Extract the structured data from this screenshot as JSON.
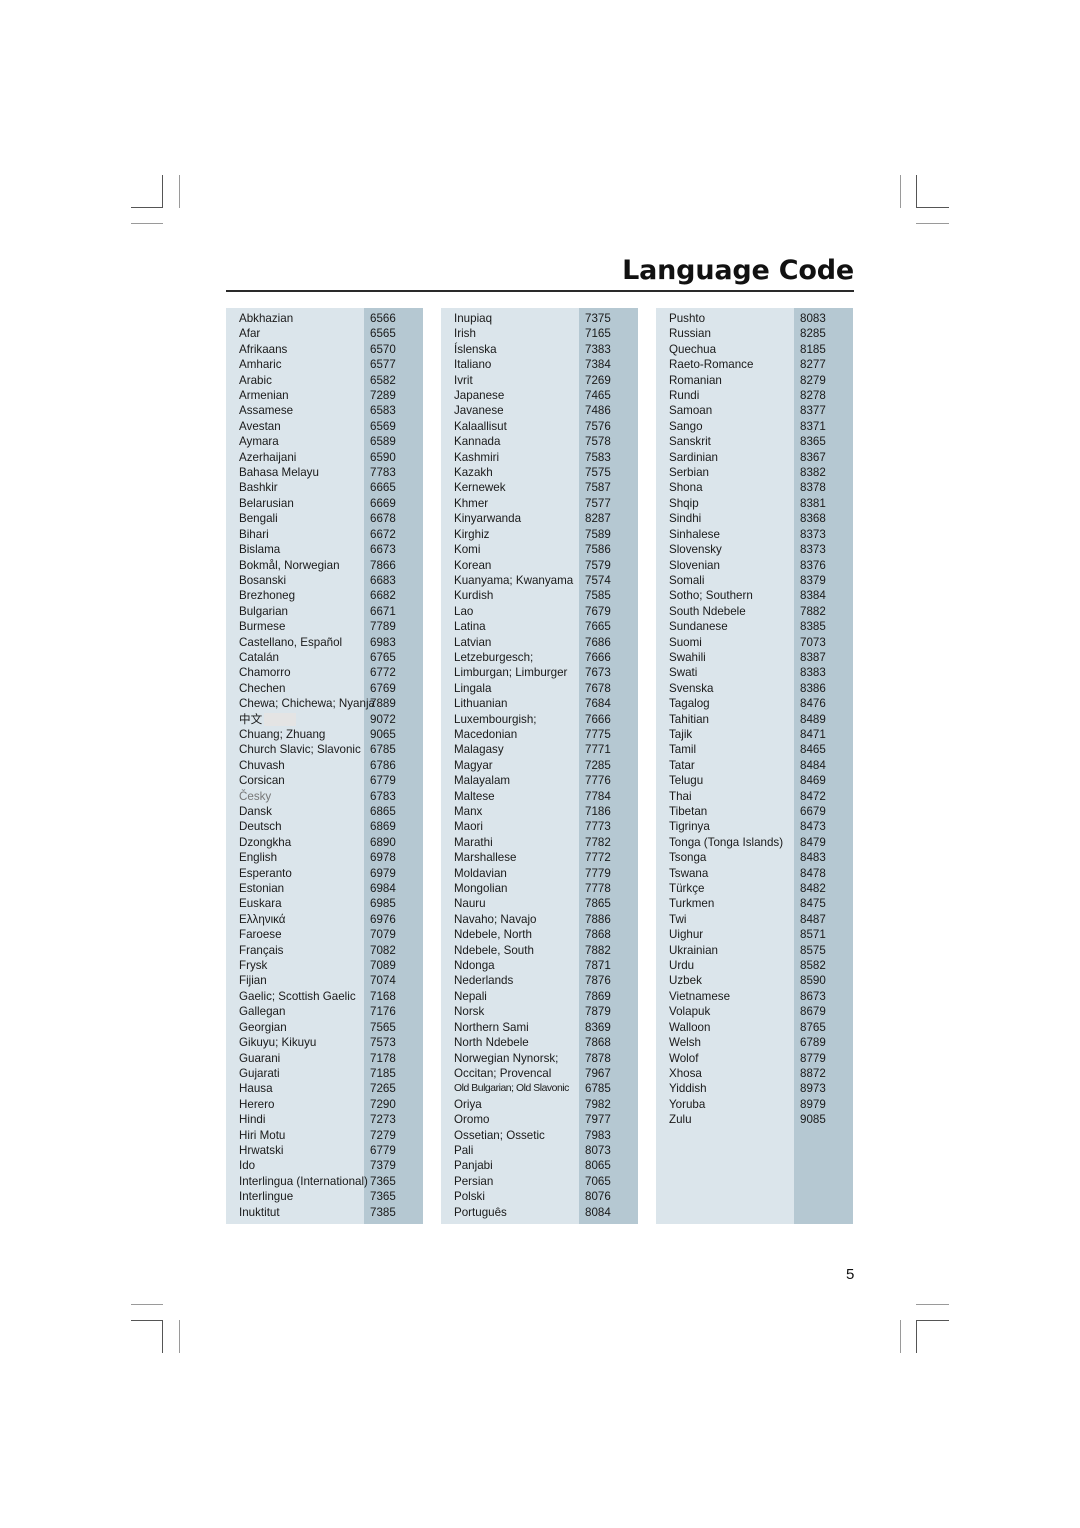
{
  "page": {
    "title": "Language Code",
    "page_number": "5"
  },
  "columns": [
    {
      "rows": [
        {
          "name": "Abkhazian",
          "code": "6566"
        },
        {
          "name": "Afar",
          "code": "6565"
        },
        {
          "name": "Afrikaans",
          "code": "6570"
        },
        {
          "name": "Amharic",
          "code": "6577"
        },
        {
          "name": "Arabic",
          "code": "6582"
        },
        {
          "name": "Armenian",
          "code": "7289"
        },
        {
          "name": "Assamese",
          "code": "6583"
        },
        {
          "name": "Avestan",
          "code": "6569"
        },
        {
          "name": "Aymara",
          "code": "6589"
        },
        {
          "name": "Azerhaijani",
          "code": "6590"
        },
        {
          "name": "Bahasa Melayu",
          "code": "7783"
        },
        {
          "name": "Bashkir",
          "code": "6665"
        },
        {
          "name": "Belarusian",
          "code": "6669"
        },
        {
          "name": "Bengali",
          "code": "6678"
        },
        {
          "name": "Bihari",
          "code": "6672"
        },
        {
          "name": "Bislama",
          "code": "6673"
        },
        {
          "name": "Bokmål, Norwegian",
          "code": "7866"
        },
        {
          "name": "Bosanski",
          "code": "6683"
        },
        {
          "name": "Brezhoneg",
          "code": "6682"
        },
        {
          "name": "Bulgarian",
          "code": "6671"
        },
        {
          "name": "Burmese",
          "code": "7789"
        },
        {
          "name": "Castellano, Español",
          "code": "6983"
        },
        {
          "name": "Catalán",
          "code": "6765"
        },
        {
          "name": "Chamorro",
          "code": "6772"
        },
        {
          "name": "Chechen",
          "code": "6769"
        },
        {
          "name": "Chewa; Chichewa; Nyanja",
          "code": "7889"
        },
        {
          "name": "中文",
          "code": "9072",
          "masked": true
        },
        {
          "name": "Chuang; Zhuang",
          "code": "9065"
        },
        {
          "name": "Church Slavic; Slavonic",
          "code": "6785"
        },
        {
          "name": "Chuvash",
          "code": "6786"
        },
        {
          "name": "Corsican",
          "code": "6779"
        },
        {
          "name": "Česky",
          "code": "6783",
          "grey": true
        },
        {
          "name": "Dansk",
          "code": "6865"
        },
        {
          "name": "Deutsch",
          "code": "6869"
        },
        {
          "name": "Dzongkha",
          "code": "6890"
        },
        {
          "name": "English",
          "code": "6978"
        },
        {
          "name": "Esperanto",
          "code": "6979"
        },
        {
          "name": "Estonian",
          "code": "6984"
        },
        {
          "name": "Euskara",
          "code": "6985"
        },
        {
          "name": "Ελληνικά",
          "code": "6976"
        },
        {
          "name": "Faroese",
          "code": "7079"
        },
        {
          "name": "Français",
          "code": "7082"
        },
        {
          "name": "Frysk",
          "code": "7089"
        },
        {
          "name": "Fijian",
          "code": "7074"
        },
        {
          "name": "Gaelic; Scottish Gaelic",
          "code": "7168"
        },
        {
          "name": "Gallegan",
          "code": "7176"
        },
        {
          "name": "Georgian",
          "code": "7565"
        },
        {
          "name": "Gikuyu; Kikuyu",
          "code": "7573"
        },
        {
          "name": "Guarani",
          "code": "7178"
        },
        {
          "name": "Gujarati",
          "code": "7185"
        },
        {
          "name": "Hausa",
          "code": "7265"
        },
        {
          "name": "Herero",
          "code": "7290"
        },
        {
          "name": "Hindi",
          "code": "7273"
        },
        {
          "name": "Hiri Motu",
          "code": "7279"
        },
        {
          "name": "Hrwatski",
          "code": "6779"
        },
        {
          "name": "Ido",
          "code": "7379"
        },
        {
          "name": "Interlingua (International)",
          "code": "7365"
        },
        {
          "name": "Interlingue",
          "code": "7365"
        },
        {
          "name": "Inuktitut",
          "code": "7385"
        }
      ]
    },
    {
      "rows": [
        {
          "name": "Inupiaq",
          "code": "7375"
        },
        {
          "name": "Irish",
          "code": "7165"
        },
        {
          "name": "Íslenska",
          "code": "7383"
        },
        {
          "name": "Italiano",
          "code": "7384"
        },
        {
          "name": "Ivrit",
          "code": "7269"
        },
        {
          "name": "Japanese",
          "code": "7465"
        },
        {
          "name": "Javanese",
          "code": "7486"
        },
        {
          "name": "Kalaallisut",
          "code": "7576"
        },
        {
          "name": "Kannada",
          "code": "7578"
        },
        {
          "name": "Kashmiri",
          "code": "7583"
        },
        {
          "name": "Kazakh",
          "code": "7575"
        },
        {
          "name": "Kernewek",
          "code": "7587"
        },
        {
          "name": "Khmer",
          "code": "7577"
        },
        {
          "name": "Kinyarwanda",
          "code": "8287"
        },
        {
          "name": "Kirghiz",
          "code": "7589"
        },
        {
          "name": "Komi",
          "code": "7586"
        },
        {
          "name": "Korean",
          "code": "7579"
        },
        {
          "name": "Kuanyama; Kwanyama",
          "code": "7574"
        },
        {
          "name": "Kurdish",
          "code": "7585"
        },
        {
          "name": "Lao",
          "code": "7679"
        },
        {
          "name": "Latina",
          "code": "7665"
        },
        {
          "name": "Latvian",
          "code": "7686"
        },
        {
          "name": "Letzeburgesch;",
          "code": "7666"
        },
        {
          "name": "Limburgan; Limburger",
          "code": "7673"
        },
        {
          "name": "Lingala",
          "code": "7678"
        },
        {
          "name": "Lithuanian",
          "code": "7684"
        },
        {
          "name": "Luxembourgish;",
          "code": "7666"
        },
        {
          "name": "Macedonian",
          "code": "7775"
        },
        {
          "name": "Malagasy",
          "code": "7771"
        },
        {
          "name": "Magyar",
          "code": "7285"
        },
        {
          "name": "Malayalam",
          "code": "7776"
        },
        {
          "name": "Maltese",
          "code": "7784"
        },
        {
          "name": "Manx",
          "code": "7186"
        },
        {
          "name": "Maori",
          "code": "7773"
        },
        {
          "name": "Marathi",
          "code": "7782"
        },
        {
          "name": "Marshallese",
          "code": "7772"
        },
        {
          "name": "Moldavian",
          "code": "7779"
        },
        {
          "name": "Mongolian",
          "code": "7778"
        },
        {
          "name": "Nauru",
          "code": "7865"
        },
        {
          "name": "Navaho; Navajo",
          "code": "7886"
        },
        {
          "name": "Ndebele, North",
          "code": "7868"
        },
        {
          "name": "Ndebele, South",
          "code": "7882"
        },
        {
          "name": "Ndonga",
          "code": "7871"
        },
        {
          "name": "Nederlands",
          "code": "7876"
        },
        {
          "name": "Nepali",
          "code": "7869"
        },
        {
          "name": "Norsk",
          "code": "7879"
        },
        {
          "name": "Northern Sami",
          "code": "8369"
        },
        {
          "name": "North Ndebele",
          "code": "7868"
        },
        {
          "name": "Norwegian Nynorsk;",
          "code": "7878"
        },
        {
          "name": "Occitan; Provencal",
          "code": "7967"
        },
        {
          "name": "Old Bulgarian; Old Slavonic",
          "code": "6785",
          "condensed": true
        },
        {
          "name": "Oriya",
          "code": "7982"
        },
        {
          "name": "Oromo",
          "code": "7977"
        },
        {
          "name": "Ossetian; Ossetic",
          "code": "7983"
        },
        {
          "name": "Pali",
          "code": "8073"
        },
        {
          "name": "Panjabi",
          "code": "8065"
        },
        {
          "name": "Persian",
          "code": "7065"
        },
        {
          "name": "Polski",
          "code": "8076"
        },
        {
          "name": "Português",
          "code": "8084"
        }
      ]
    },
    {
      "rows": [
        {
          "name": "Pushto",
          "code": "8083"
        },
        {
          "name": "Russian",
          "code": "8285"
        },
        {
          "name": "Quechua",
          "code": "8185"
        },
        {
          "name": "Raeto-Romance",
          "code": "8277"
        },
        {
          "name": "Romanian",
          "code": "8279"
        },
        {
          "name": "Rundi",
          "code": "8278"
        },
        {
          "name": "Samoan",
          "code": "8377"
        },
        {
          "name": "Sango",
          "code": "8371"
        },
        {
          "name": "Sanskrit",
          "code": "8365"
        },
        {
          "name": "Sardinian",
          "code": "8367"
        },
        {
          "name": "Serbian",
          "code": "8382"
        },
        {
          "name": "Shona",
          "code": "8378"
        },
        {
          "name": "Shqip",
          "code": "8381"
        },
        {
          "name": "Sindhi",
          "code": "8368"
        },
        {
          "name": "Sinhalese",
          "code": "8373"
        },
        {
          "name": "Slovensky",
          "code": "8373"
        },
        {
          "name": "Slovenian",
          "code": "8376"
        },
        {
          "name": "Somali",
          "code": "8379"
        },
        {
          "name": "Sotho; Southern",
          "code": "8384"
        },
        {
          "name": "South Ndebele",
          "code": "7882"
        },
        {
          "name": "Sundanese",
          "code": "8385"
        },
        {
          "name": "Suomi",
          "code": "7073"
        },
        {
          "name": "Swahili",
          "code": "8387"
        },
        {
          "name": "Swati",
          "code": "8383"
        },
        {
          "name": "Svenska",
          "code": "8386"
        },
        {
          "name": "Tagalog",
          "code": "8476"
        },
        {
          "name": "Tahitian",
          "code": "8489"
        },
        {
          "name": "Tajik",
          "code": "8471"
        },
        {
          "name": "Tamil",
          "code": "8465"
        },
        {
          "name": "Tatar",
          "code": "8484"
        },
        {
          "name": "Telugu",
          "code": "8469"
        },
        {
          "name": "Thai",
          "code": "8472"
        },
        {
          "name": "Tibetan",
          "code": "6679"
        },
        {
          "name": "Tigrinya",
          "code": "8473"
        },
        {
          "name": "Tonga (Tonga Islands)",
          "code": "8479"
        },
        {
          "name": "Tsonga",
          "code": "8483"
        },
        {
          "name": "Tswana",
          "code": "8478"
        },
        {
          "name": "Türkçe",
          "code": "8482"
        },
        {
          "name": "Turkmen",
          "code": "8475"
        },
        {
          "name": "Twi",
          "code": "8487"
        },
        {
          "name": "Uighur",
          "code": "8571"
        },
        {
          "name": "Ukrainian",
          "code": "8575"
        },
        {
          "name": "Urdu",
          "code": "8582"
        },
        {
          "name": "Uzbek",
          "code": "8590"
        },
        {
          "name": "Vietnamese",
          "code": "8673"
        },
        {
          "name": "Volapuk",
          "code": "8679"
        },
        {
          "name": "Walloon",
          "code": "8765"
        },
        {
          "name": "Welsh",
          "code": "6789"
        },
        {
          "name": "Wolof",
          "code": "8779"
        },
        {
          "name": "Xhosa",
          "code": "8872"
        },
        {
          "name": "Yiddish",
          "code": "8973"
        },
        {
          "name": "Yoruba",
          "code": "8979"
        },
        {
          "name": "Zulu",
          "code": "9085"
        }
      ]
    }
  ]
}
